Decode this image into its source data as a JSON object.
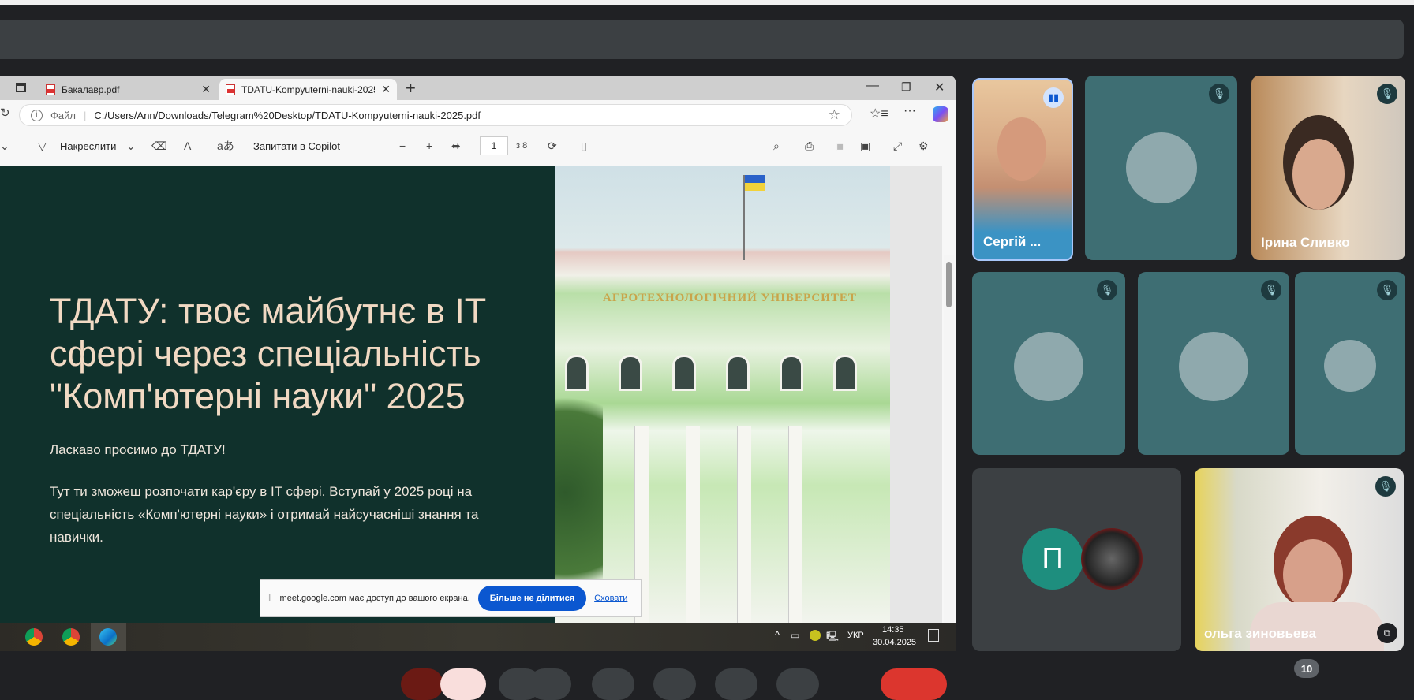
{
  "browser": {
    "tabs": [
      {
        "label": "Бакалавр.pdf",
        "active": false
      },
      {
        "label": "TDATU-Kompyuterni-nauki-2025.p",
        "active": true
      }
    ],
    "address": {
      "prefix": "Файл",
      "url": "C:/Users/Ann/Downloads/Telegram%20Desktop/TDATU-Kompyuterni-nauki-2025.pdf"
    },
    "toolbar": {
      "draw": "Накреслити",
      "copilot": "Запитати в Copilot",
      "page": "1",
      "page_total": "з 8"
    }
  },
  "pdf": {
    "headline": "ТДАТУ: твоє майбутнє в IT сфері через спеціальність \"Комп'ютерні науки\" 2025",
    "welcome": "Ласкаво просимо до ТДАТУ!",
    "body": "Тут ти зможеш розпочати кар'єру в IT сфері. Вступай у 2025 році на спеціальність «Комп'ютерні науки» і отримай найсучасніші знання та навички.",
    "sign": "АГРОТЕХНОЛОГІЧНИЙ УНІВЕРСИТЕТ"
  },
  "share_notice": {
    "text": "meet.google.com має доступ до вашого екрана.",
    "stop": "Більше не ділитися",
    "hide": "Сховати"
  },
  "taskbar": {
    "lang": "УКР",
    "time": "14:35",
    "date": "30.04.2025"
  },
  "meet": {
    "participants": [
      {
        "name": "Сергій ..."
      },
      {
        "name": "Ірина Сливко"
      },
      {
        "name": "ольга зиновьева"
      }
    ],
    "avatar_letter": "П",
    "participant_count": "10"
  }
}
